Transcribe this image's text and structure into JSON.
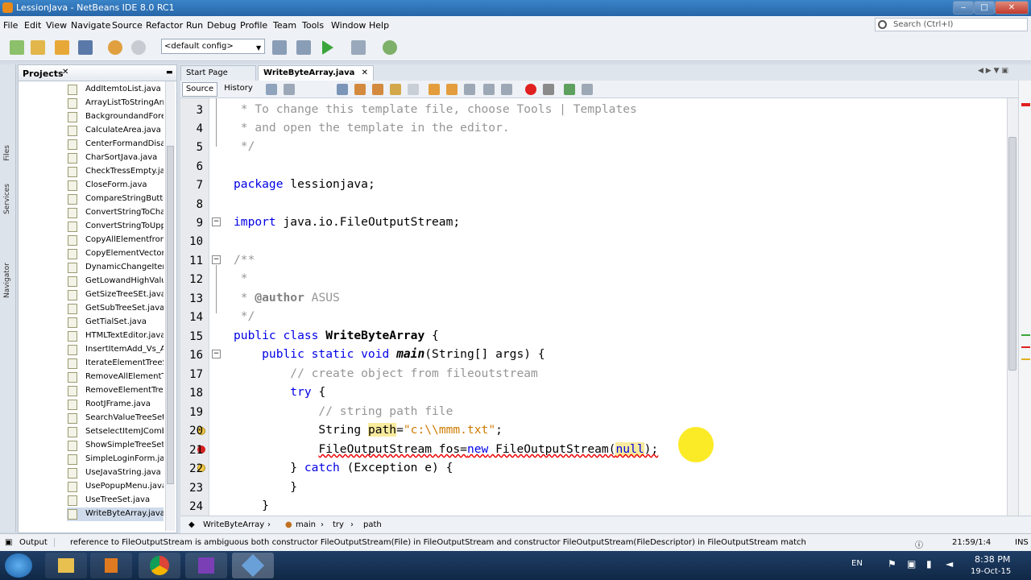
{
  "window": {
    "title": "LessionJava - NetBeans IDE 8.0 RC1",
    "btn_min": "‒",
    "btn_max": "□",
    "btn_close": "✕"
  },
  "menu": [
    "File",
    "Edit",
    "View",
    "Navigate",
    "Source",
    "Refactor",
    "Run",
    "Debug",
    "Profile",
    "Team",
    "Tools",
    "Window",
    "Help"
  ],
  "search": {
    "placeholder": "Search (Ctrl+I)"
  },
  "toolbar": {
    "config": "<default config>"
  },
  "side_tabs": {
    "files": "Files",
    "services": "Services",
    "navigator": "Navigator"
  },
  "projects": {
    "title": "Projects",
    "files": [
      "AddItemtoList.java",
      "ArrayListToStringArra",
      "BackgroundandForegr",
      "CalculateArea.java",
      "CenterFormandDisabl",
      "CharSortJava.java",
      "CheckTressEmpty.java",
      "CloseForm.java",
      "CompareStringButton",
      "ConvertStringToChar",
      "ConvertStringToUppe",
      "CopyAllElementfromA",
      "CopyElementVectorto",
      "DynamicChangeItem.",
      "GetLowandHighValue.",
      "GetSizeTreeSEt.java",
      "GetSubTreeSet.java",
      "GetTialSet.java",
      "HTMLTextEditor.java",
      "InsertItemAdd_Vs_Ac",
      "IterateElementTreeSe",
      "RemoveAllElementTre",
      "RemoveElementTreeS",
      "RootJFrame.java",
      "SearchValueTreeSet.j",
      "SetselectItemJCombo",
      "ShowSimpleTreeSet.ja",
      "SimpleLoginForm.java",
      "UseJavaString.java",
      "UsePopupMenu.java",
      "UseTreeSet.java",
      "WriteByteArray.java"
    ]
  },
  "tabs": [
    {
      "label": "Start Page"
    },
    {
      "label": "WriteByteArray.java"
    }
  ],
  "editor": {
    "source": "Source",
    "history": "History",
    "lines": [
      "3",
      "4",
      "5",
      "6",
      "7",
      "8",
      "9",
      "10",
      "11",
      "12",
      "13",
      "14",
      "15",
      "16",
      "17",
      "18",
      "19",
      "20",
      "21",
      "22",
      "23",
      "24"
    ],
    "code": {
      "l3": " * To change this template file, choose Tools | Templates",
      "l4": " * and open the template in the editor.",
      "l5": " */",
      "l7_kw": "package",
      "l7_rest": " lessionjava;",
      "l9_kw": "import",
      "l9_rest": " java.io.FileOutputStream;",
      "l11": "/**",
      "l12": " *",
      "l13_a": " * ",
      "l13_tag": "@author",
      "l13_b": " ASUS",
      "l14": " */",
      "l15_kw": "public class ",
      "l15_name": "WriteByteArray",
      "l15_rest": " {",
      "l16_kw": "    public static void ",
      "l16_name": "main",
      "l16_rest": "(String[] args) {",
      "l17": "        // create object from fileoutstream",
      "l18_kw": "        try",
      "l18_rest": " {",
      "l19": "            // string path file",
      "l20_a": "            String ",
      "l20_var": "path",
      "l20_b": "=",
      "l20_str": "\"c:\\\\mmm.txt\"",
      "l20_c": ";",
      "l21_ind": "            ",
      "l21_a": "FileOutputStream fos=",
      "l21_kw": "new",
      "l21_b": " FileOutputStream(",
      "l21_null": "null",
      "l21_c": ");",
      "l22_a": "        } ",
      "l22_kw": "catch",
      "l22_b": " (Exception e) {",
      "l23": "        }",
      "l24": "    }"
    }
  },
  "breadcrumbs": [
    "WriteByteArray",
    "main",
    "try",
    "path"
  ],
  "status": {
    "output": "Output",
    "message": "reference to FileOutputStream is ambiguous   both constructor FileOutputStream(File) in FileOutputStream and constructor FileOutputStream(FileDescriptor) in FileOutputStream match",
    "position": "21:59/1:4",
    "mode": "INS"
  },
  "taskbar": {
    "lang": "EN",
    "time": "8:38 PM",
    "date": "19-Oct-15"
  }
}
